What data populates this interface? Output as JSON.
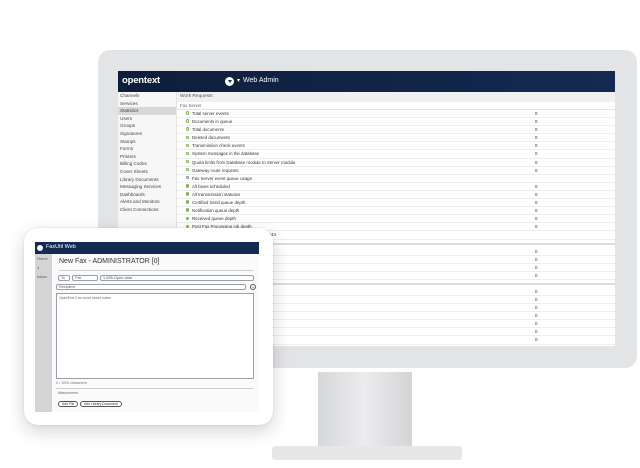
{
  "desktop": {
    "brand": "opentext",
    "app_title": "Web Admin",
    "sidebar": [
      {
        "label": "Channels"
      },
      {
        "label": "Services"
      },
      {
        "label": "Statistics"
      },
      {
        "label": "Users"
      },
      {
        "label": "Groups"
      },
      {
        "label": "Signatures"
      },
      {
        "label": "Stamps"
      },
      {
        "label": "Forms"
      },
      {
        "label": "Printers"
      },
      {
        "label": "Billing Codes"
      },
      {
        "label": "Cover Sheets"
      },
      {
        "label": "Library Documents"
      },
      {
        "label": "Messaging Services"
      },
      {
        "label": "Dashboards"
      },
      {
        "label": "Alerts and Monitors"
      },
      {
        "label": "Client Connections"
      }
    ],
    "breadcrumb": "Work Requests",
    "section_title": "Fax Server",
    "rows": [
      {
        "label": "Total server events",
        "value": "0"
      },
      {
        "label": "Documents in queue",
        "value": "0"
      },
      {
        "label": "Total documents",
        "value": "0"
      },
      {
        "label": "Deleted documents",
        "value": "0"
      },
      {
        "label": "Transmission check events",
        "value": "0"
      },
      {
        "label": "System messages in the database",
        "value": "0"
      },
      {
        "label": "Quota limits from Database module to Server module",
        "value": "0"
      },
      {
        "label": "Gateway route requests",
        "value": "0"
      },
      {
        "label": "Fax Server event queue usage",
        "value": ""
      },
      {
        "label": "All faxes scheduled",
        "value": "0"
      },
      {
        "label": "All transmission statuses",
        "value": "0"
      },
      {
        "label": "Certified Send queue depth",
        "value": "0"
      },
      {
        "label": "Notification queue depth",
        "value": "0"
      },
      {
        "label": "Received queue depth",
        "value": "0"
      },
      {
        "label": "Post Fax Processing job depth",
        "value": "0"
      },
      {
        "label": "Fax Server events processed on MAIN 244",
        "value": ""
      }
    ],
    "section2_values": [
      "0",
      "0",
      "0",
      "0"
    ],
    "section3_values": [
      "0",
      "0",
      "0",
      "0",
      "0",
      "0",
      "0"
    ]
  },
  "tablet": {
    "app_title": "FaxUtil Web",
    "side_labels": [
      "Home",
      "1",
      "Inbox"
    ],
    "heading": "New Fax - ADMINISTRATOR [0]",
    "to_label": "To",
    "method_value": "Fax",
    "to_value": "1-555-Open-data",
    "recipients_placeholder": "Recipient",
    "body_text": "OpenText Fax cover sheet notes",
    "char_counter": "0 / 1000 characters",
    "attachments_label": "Attachments",
    "add_file_label": "Add File",
    "add_library_label": "Add Library Document"
  }
}
